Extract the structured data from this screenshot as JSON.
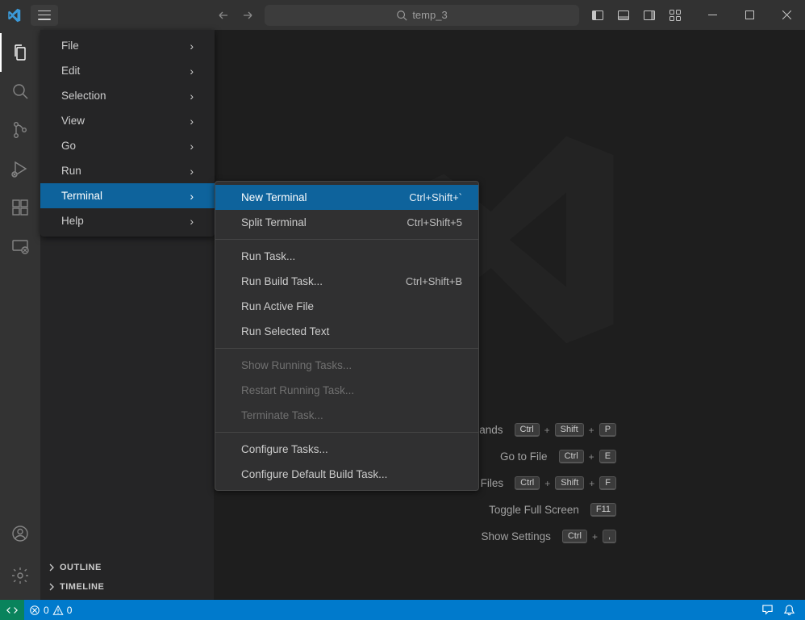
{
  "titlebar": {
    "search_placeholder": "temp_3"
  },
  "menu": {
    "items": [
      {
        "label": "File"
      },
      {
        "label": "Edit"
      },
      {
        "label": "Selection"
      },
      {
        "label": "View"
      },
      {
        "label": "Go"
      },
      {
        "label": "Run"
      },
      {
        "label": "Terminal"
      },
      {
        "label": "Help"
      }
    ]
  },
  "submenu": {
    "items": [
      {
        "label": "New Terminal",
        "shortcut": "Ctrl+Shift+`"
      },
      {
        "label": "Split Terminal",
        "shortcut": "Ctrl+Shift+5"
      },
      {
        "label": "Run Task..."
      },
      {
        "label": "Run Build Task...",
        "shortcut": "Ctrl+Shift+B"
      },
      {
        "label": "Run Active File"
      },
      {
        "label": "Run Selected Text"
      },
      {
        "label": "Show Running Tasks..."
      },
      {
        "label": "Restart Running Task..."
      },
      {
        "label": "Terminate Task..."
      },
      {
        "label": "Configure Tasks..."
      },
      {
        "label": "Configure Default Build Task..."
      }
    ]
  },
  "sidebar": {
    "outline": "OUTLINE",
    "timeline": "TIMELINE"
  },
  "welcome": {
    "rows": [
      {
        "label": "Show All Commands",
        "keys": [
          "Ctrl",
          "+",
          "Shift",
          "+",
          "P"
        ]
      },
      {
        "label": "Go to File",
        "keys": [
          "Ctrl",
          "+",
          "E"
        ]
      },
      {
        "label": "Find in Files",
        "keys": [
          "Ctrl",
          "+",
          "Shift",
          "+",
          "F"
        ]
      },
      {
        "label": "Toggle Full Screen",
        "keys": [
          "F11"
        ]
      },
      {
        "label": "Show Settings",
        "keys": [
          "Ctrl",
          "+",
          ","
        ]
      }
    ]
  },
  "status": {
    "errors": "0",
    "warnings": "0"
  }
}
